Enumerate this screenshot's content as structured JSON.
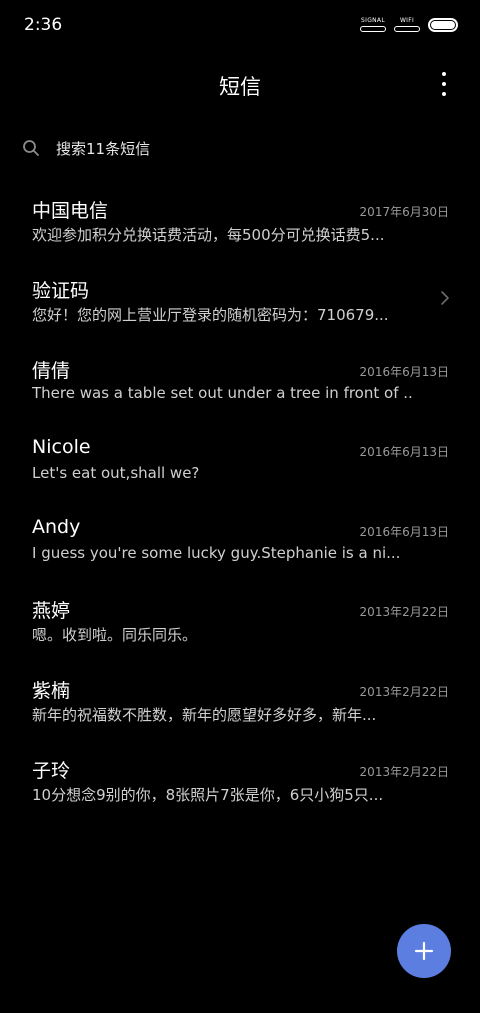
{
  "status_bar": {
    "time": "2:36",
    "signal_label": "SIGNAL",
    "wifi_label": "WIFI"
  },
  "header": {
    "title": "短信"
  },
  "search": {
    "placeholder": "搜索11条短信"
  },
  "conversations": [
    {
      "name": "中国电信",
      "date": "2017年6月30日",
      "preview": "欢迎参加积分兑换话费活动，每500分可兑换话费5..."
    },
    {
      "name": "验证码",
      "date": "",
      "preview": "您好！您的网上营业厅登录的随机密码为：710679..."
    },
    {
      "name": "倩倩",
      "date": "2016年6月13日",
      "preview": "There was a table set out under a tree in front of ..."
    },
    {
      "name": "Nicole",
      "date": "2016年6月13日",
      "preview": "Let's eat out,shall we?"
    },
    {
      "name": "Andy",
      "date": "2016年6月13日",
      "preview": "I guess you're some lucky guy.Stephanie is a ni..."
    },
    {
      "name": "燕婷",
      "date": "2013年2月22日",
      "preview": "嗯。收到啦。同乐同乐。"
    },
    {
      "name": "紫楠",
      "date": "2013年2月22日",
      "preview": "新年的祝福数不胜数，新年的愿望好多好多，新年..."
    },
    {
      "name": "子玲",
      "date": "2013年2月22日",
      "preview": "10分想念9别的你，8张照片7张是你，6只小狗5只..."
    }
  ],
  "colors": {
    "background": "#000000",
    "fab": "#5b7ee0",
    "date_text": "#9a9a9a"
  },
  "icons": {
    "search": "search-icon",
    "more": "more-vertical-icon",
    "chevron": "chevron-right-icon",
    "fab": "plus-icon"
  }
}
